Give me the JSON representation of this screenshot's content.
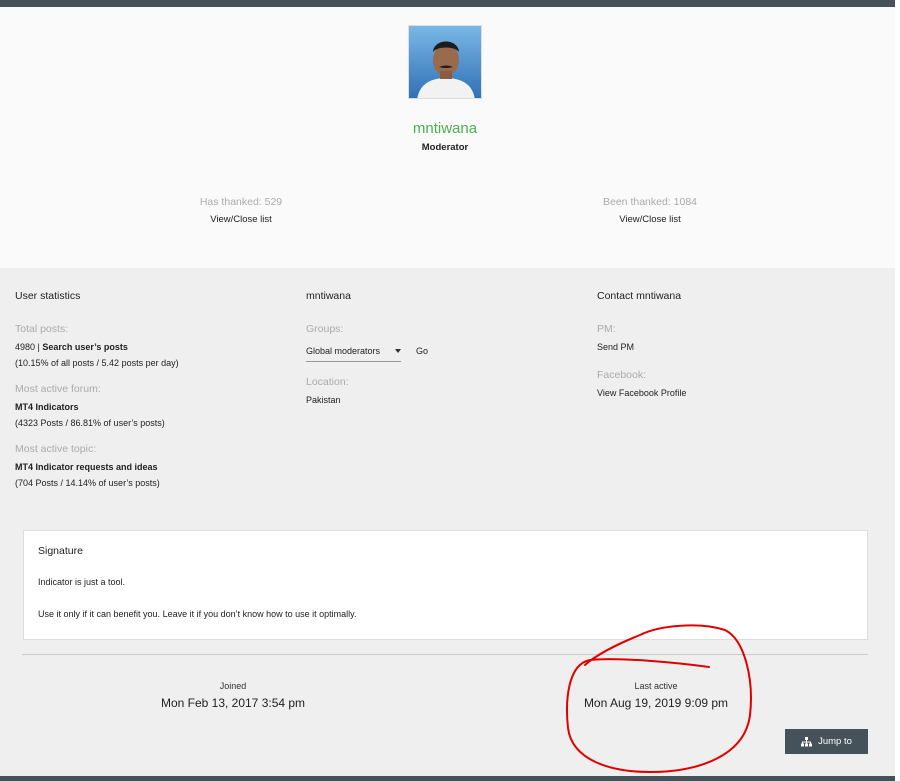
{
  "profile": {
    "username": "mntiwana",
    "rank": "Moderator",
    "has_thanked": "Has thanked: 529",
    "been_thanked": "Been thanked: 1084",
    "view_close_list": "View/Close list"
  },
  "stats": {
    "heading": "User statistics",
    "total_posts_label": "Total posts:",
    "total_posts_count": "4980",
    "search_posts": "Search user’s posts",
    "total_posts_detail": "(10.15% of all posts / 5.42 posts per day)",
    "most_active_forum_label": "Most active forum:",
    "most_active_forum": "MT4 Indicators",
    "most_active_forum_detail": "(4323 Posts / 86.81% of user’s posts)",
    "most_active_topic_label": "Most active topic:",
    "most_active_topic": "MT4 Indicator requests and ideas",
    "most_active_topic_detail": "(704 Posts / 14.14% of user’s posts)"
  },
  "info": {
    "heading": "mntiwana",
    "groups_label": "Groups:",
    "group_selected": "Global moderators",
    "go_label": "Go",
    "location_label": "Location:",
    "location": "Pakistan"
  },
  "contact": {
    "heading": "Contact mntiwana",
    "pm_label": "PM:",
    "send_pm": "Send PM",
    "facebook_label": "Facebook:",
    "facebook_link": "View Facebook Profile"
  },
  "signature": {
    "heading": "Signature",
    "line1": "Indicator is just a tool.",
    "line2": "Use it only if it can benefit you. Leave it if you don’t know how to use it optimally."
  },
  "dates": {
    "joined_label": "Joined",
    "joined": "Mon Feb 13, 2017 3:54 pm",
    "last_active_label": "Last active",
    "last_active": "Mon Aug 19, 2019 9:09 pm"
  },
  "jump": {
    "label": "Jump to",
    "icon": "sitemap-icon"
  },
  "colors": {
    "username": "#4caf50",
    "bar": "#46525a",
    "annotation": "#e00000"
  }
}
